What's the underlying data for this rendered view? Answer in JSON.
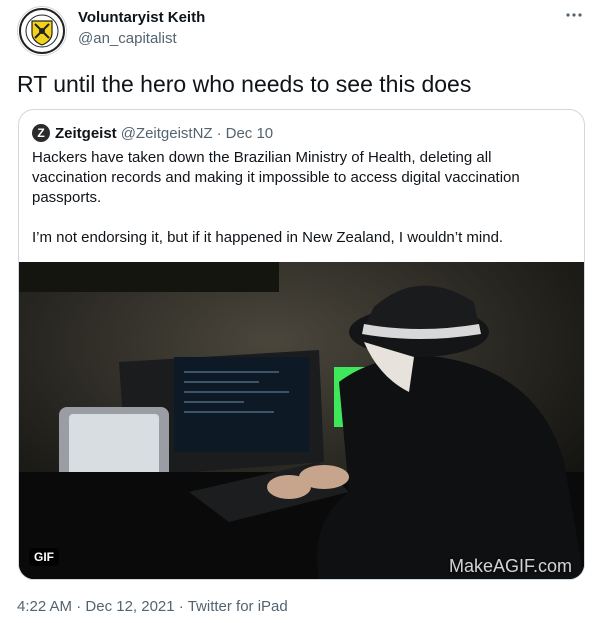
{
  "author": {
    "display_name": "Voluntaryist Keith",
    "handle": "@an_capitalist",
    "avatar_icon": "coat-of-arms-icon"
  },
  "more_icon": "more-horizontal-icon",
  "tweet_text": "RT until the hero who needs to see this does",
  "quoted_tweet": {
    "avatar_letter": "Z",
    "display_name": "Zeitgeist",
    "handle": "@ZeitgeistNZ",
    "separator": "·",
    "date": "Dec 10",
    "paragraphs": [
      "Hackers have taken down the Brazilian Ministry of Health, deleting all vaccination records and making it impossible to access digital vaccination passports.",
      "I’m not endorsing it, but if it happened in New Zealand, I wouldn’t mind."
    ],
    "media": {
      "badge": "GIF",
      "watermark": "MakeAGIF.com"
    }
  },
  "footer": {
    "time": "4:22 AM",
    "sep1": "·",
    "date": "Dec 12, 2021",
    "sep2": "·",
    "source": "Twitter for iPad"
  },
  "colors": {
    "text": "#0f1419",
    "secondary": "#536471",
    "border": "#cfd9de"
  }
}
